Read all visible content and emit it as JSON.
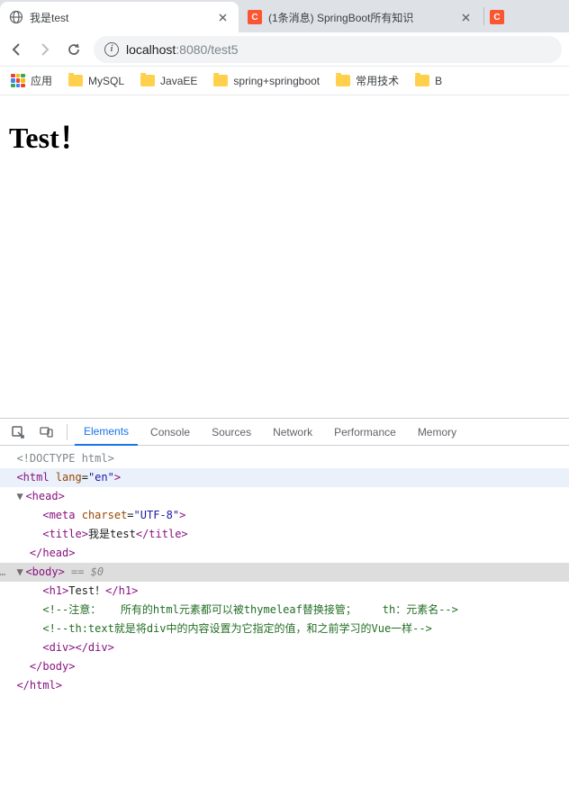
{
  "tabs": {
    "active": {
      "title": "我是test"
    },
    "inactive1": {
      "title": "(1条消息) SpringBoot所有知识",
      "badge": "C"
    },
    "inactive2_badge": "C"
  },
  "url": {
    "host": "localhost",
    "port": ":8080",
    "path": "/test5"
  },
  "bookmarks": {
    "apps": "应用",
    "items": [
      "MySQL",
      "JavaEE",
      "spring+springboot",
      "常用技术",
      "B"
    ]
  },
  "content": {
    "heading": "Test！"
  },
  "devtools": {
    "tabs": [
      "Elements",
      "Console",
      "Sources",
      "Network",
      "Performance",
      "Memory"
    ]
  },
  "dom": {
    "doctype": "<!DOCTYPE html>",
    "html_open": "<html ",
    "lang_attr": "lang",
    "lang_val": "\"en\"",
    "html_close_bracket": ">",
    "head_open": "<head>",
    "meta_open": "<meta ",
    "charset_attr": "charset",
    "charset_val": "\"UTF-8\"",
    "meta_close": ">",
    "title_open": "<title>",
    "title_text": "我是test",
    "title_close": "</title>",
    "head_close": "</head>",
    "body_open": "<body>",
    "body_sel": " == $0",
    "h1_open": "<h1>",
    "h1_text": "Test！",
    "h1_close": "</h1>",
    "comment1": "<!--注意：   所有的html元素都可以被thymeleaf替换接管；    th：元素名-->",
    "comment2": "<!--th:text就是将div中的内容设置为它指定的值，和之前学习的Vue一样-->",
    "div_open": "<div>",
    "div_close": "</div>",
    "body_close": "</body>",
    "html_close": "</html>"
  }
}
